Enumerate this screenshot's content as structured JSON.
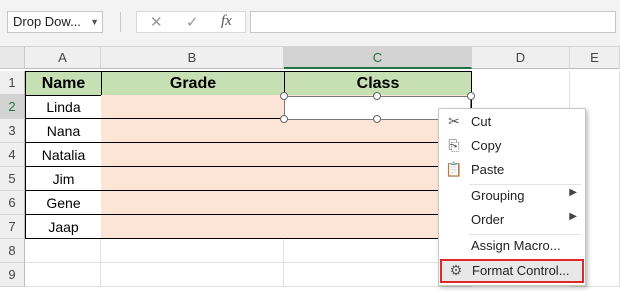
{
  "formula_bar": {
    "name_box": "Drop Dow...",
    "cancel_symbol": "✕",
    "enter_symbol": "✓",
    "fx_symbol": "fx",
    "formula": ""
  },
  "columns": [
    "A",
    "B",
    "C",
    "D",
    "E"
  ],
  "rows": [
    "1",
    "2",
    "3",
    "4",
    "5",
    "6",
    "7",
    "8",
    "9"
  ],
  "table": {
    "headers": {
      "name": "Name",
      "grade": "Grade",
      "class": "Class"
    },
    "names": [
      "Linda",
      "Nana",
      "Natalia",
      "Jim",
      "Gene",
      "Jaap"
    ]
  },
  "context_menu": {
    "cut": "Cut",
    "copy": "Copy",
    "paste": "Paste",
    "grouping": "Grouping",
    "order": "Order",
    "assign_macro": "Assign Macro...",
    "format_control": "Format Control..."
  },
  "colors": {
    "header_fill": "#c6e0b4",
    "data_fill": "#fce4d6",
    "selection_accent": "#217346",
    "highlight_border": "#e0282a"
  }
}
